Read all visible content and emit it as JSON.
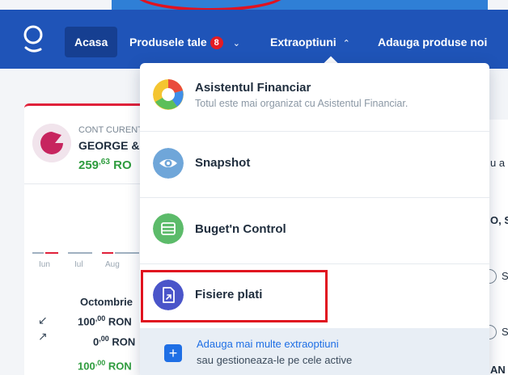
{
  "nav": {
    "items": [
      {
        "label": "Acasa"
      },
      {
        "label": "Produsele tale",
        "badge": "8"
      },
      {
        "label": "Extraoptiuni"
      },
      {
        "label": "Adauga produse noi"
      }
    ]
  },
  "background": {
    "account_type": "CONT CURENT",
    "account_holder": "GEORGE &",
    "balance_main": "259",
    "balance_decimals": ",63",
    "balance_currency": "RO",
    "months": [
      "Iun",
      "Iul",
      "Aug"
    ],
    "month_title": "Octombrie",
    "amount_in": "100",
    "amount_in_dec": ",00",
    "amount_out": "0",
    "amount_out_dec": ",00",
    "amount_total": "100",
    "amount_total_dec": ",00",
    "currency": "RON",
    "right_fragments": [
      "u a",
      "O, S",
      "S",
      "S",
      "AN"
    ]
  },
  "dropdown": {
    "items": [
      {
        "title": "Asistentul Financiar",
        "subtitle": "Totul este mai organizat cu Asistentul Financiar.",
        "icon": "pie-chart-icon"
      },
      {
        "title": "Snapshot",
        "icon": "eye-icon"
      },
      {
        "title": "Buget'n Control",
        "icon": "clapperboard-icon"
      },
      {
        "title": "Fisiere plati",
        "icon": "file-arrow-icon"
      }
    ],
    "footer_link": "Adauga mai multe extraoptiuni",
    "footer_sub": "sau gestioneaza-le pe cele active"
  },
  "colors": {
    "nav_bg": "#1f54b8",
    "accent_red": "#e0121f",
    "positive_green": "#2e9c3e",
    "link_blue": "#1f6fe5"
  }
}
